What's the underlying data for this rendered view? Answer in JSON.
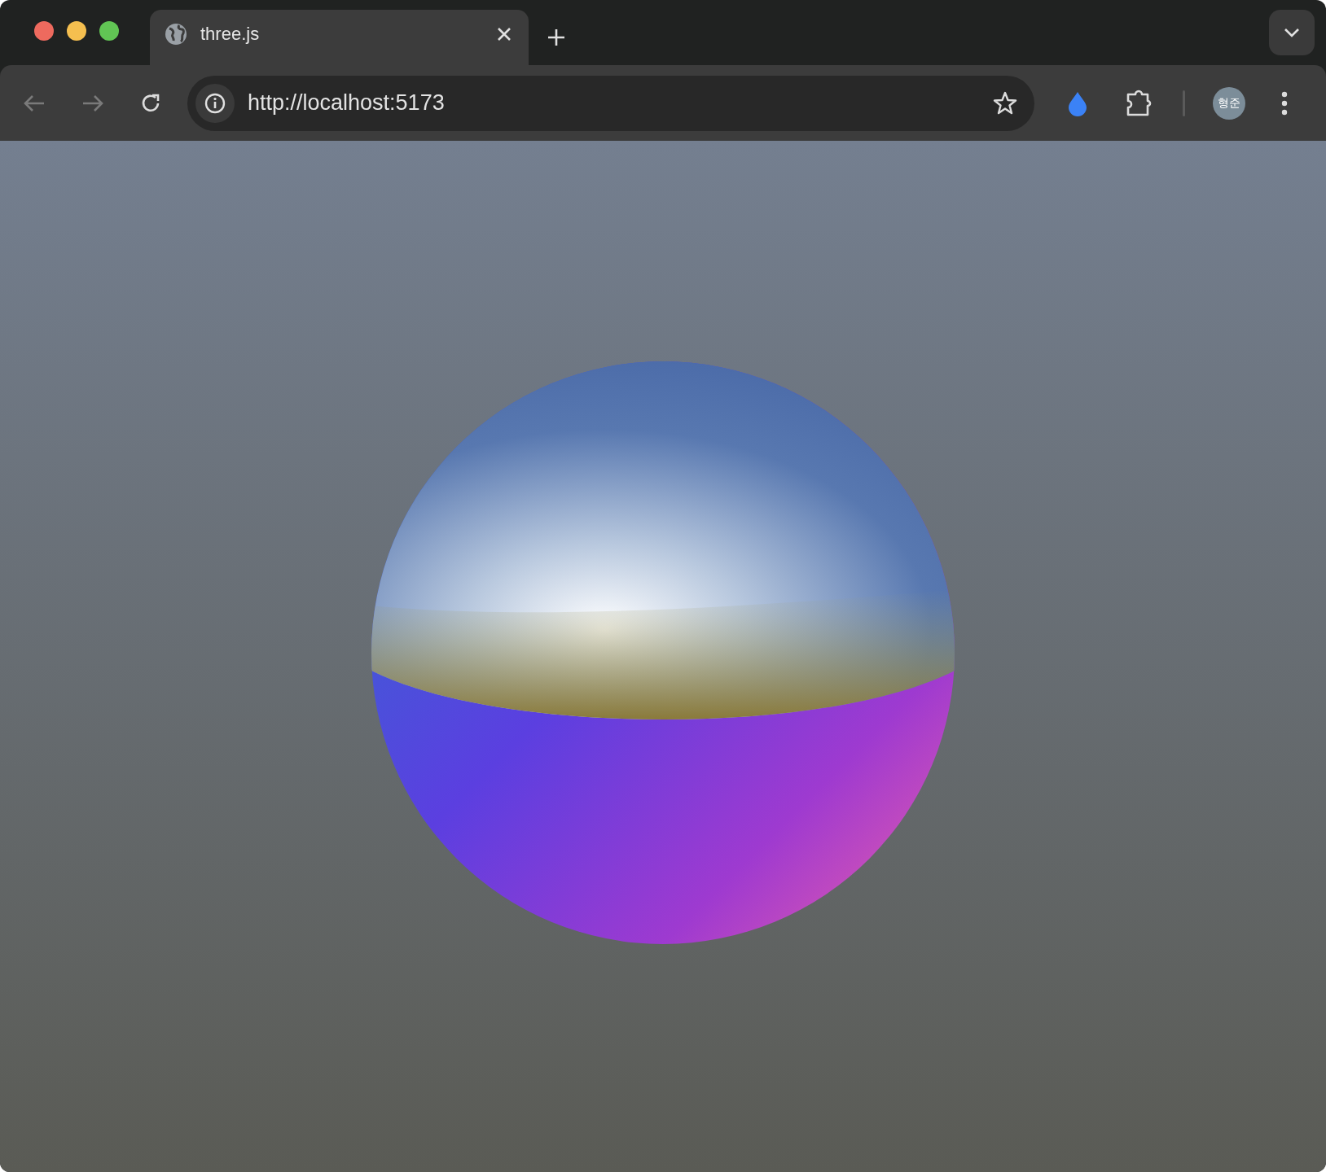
{
  "tabs": [
    {
      "title": "three.js",
      "selected": true
    }
  ],
  "address_bar": {
    "url": "http://localhost:5173"
  },
  "profile": {
    "initials": "형준"
  }
}
